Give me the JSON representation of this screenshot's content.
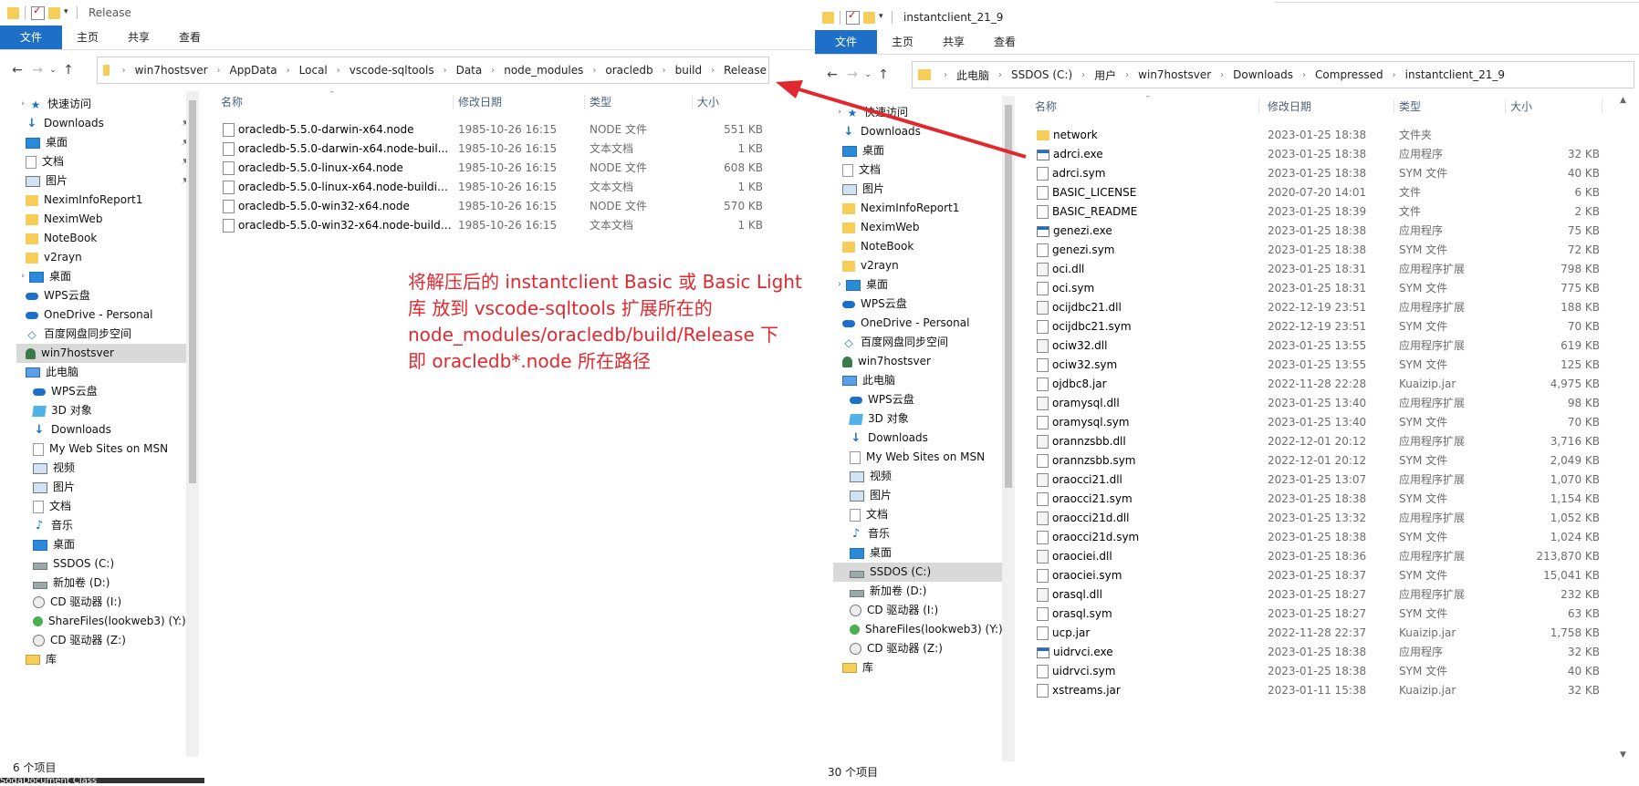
{
  "left": {
    "title": "Release",
    "ribbon_tabs": [
      "文件",
      "主页",
      "共享",
      "查看"
    ],
    "breadcrumb": [
      "win7hostsver",
      "AppData",
      "Local",
      "vscode-sqltools",
      "Data",
      "node_modules",
      "oracledb",
      "build",
      "Release"
    ],
    "nav": [
      {
        "label": "快速访问",
        "icon": "star-icon",
        "level": 0
      },
      {
        "label": "Downloads",
        "icon": "download-icon",
        "level": 1,
        "pinned": true
      },
      {
        "label": "桌面",
        "icon": "desktop-icon",
        "level": 1,
        "pinned": true
      },
      {
        "label": "文档",
        "icon": "document-icon",
        "level": 1,
        "pinned": true
      },
      {
        "label": "图片",
        "icon": "picture-icon",
        "level": 1,
        "pinned": true
      },
      {
        "label": "NeximInfoReport1",
        "icon": "folder-icon",
        "level": 1
      },
      {
        "label": "NeximWeb",
        "icon": "folder-icon",
        "level": 1
      },
      {
        "label": "NoteBook",
        "icon": "folder-icon",
        "level": 1
      },
      {
        "label": "v2rayn",
        "icon": "folder-icon",
        "level": 1
      },
      {
        "label": "桌面",
        "icon": "desktop-icon",
        "level": 0
      },
      {
        "label": "WPS云盘",
        "icon": "cloud-icon",
        "level": 1
      },
      {
        "label": "OneDrive - Personal",
        "icon": "cloud-icon",
        "level": 1
      },
      {
        "label": "百度网盘同步空间",
        "icon": "baidu-icon",
        "level": 1
      },
      {
        "label": "win7hostsver",
        "icon": "user-icon",
        "level": 1,
        "selected": true
      },
      {
        "label": "此电脑",
        "icon": "computer-icon",
        "level": 1
      },
      {
        "label": "WPS云盘",
        "icon": "cloud-icon",
        "level": 2
      },
      {
        "label": "3D 对象",
        "icon": "cube-icon",
        "level": 2
      },
      {
        "label": "Downloads",
        "icon": "download-icon",
        "level": 2
      },
      {
        "label": "My Web Sites on MSN",
        "icon": "document-icon",
        "level": 2
      },
      {
        "label": "视频",
        "icon": "video-icon",
        "level": 2
      },
      {
        "label": "图片",
        "icon": "picture-icon",
        "level": 2
      },
      {
        "label": "文档",
        "icon": "document-icon",
        "level": 2
      },
      {
        "label": "音乐",
        "icon": "music-icon",
        "level": 2
      },
      {
        "label": "桌面",
        "icon": "desktop-icon",
        "level": 2
      },
      {
        "label": "SSDOS (C:)",
        "icon": "drive-icon",
        "level": 2
      },
      {
        "label": "新加卷 (D:)",
        "icon": "drive-icon",
        "level": 2
      },
      {
        "label": "CD 驱动器 (I:)",
        "icon": "cd-icon",
        "level": 2
      },
      {
        "label": "ShareFiles(lookweb3) (Y:)",
        "icon": "network-drive-icon",
        "level": 2
      },
      {
        "label": "CD 驱动器 (Z:)",
        "icon": "cd-icon",
        "level": 2
      },
      {
        "label": "库",
        "icon": "library-icon",
        "level": 1
      }
    ],
    "columns": [
      "名称",
      "修改日期",
      "类型",
      "大小"
    ],
    "files": [
      {
        "name": "oracledb-5.5.0-darwin-x64.node",
        "date": "1985-10-26 16:15",
        "type": "NODE 文件",
        "size": "551 KB"
      },
      {
        "name": "oracledb-5.5.0-darwin-x64.node-buil...",
        "date": "1985-10-26 16:15",
        "type": "文本文档",
        "size": "1 KB"
      },
      {
        "name": "oracledb-5.5.0-linux-x64.node",
        "date": "1985-10-26 16:15",
        "type": "NODE 文件",
        "size": "608 KB"
      },
      {
        "name": "oracledb-5.5.0-linux-x64.node-buildin...",
        "date": "1985-10-26 16:15",
        "type": "文本文档",
        "size": "1 KB"
      },
      {
        "name": "oracledb-5.5.0-win32-x64.node",
        "date": "1985-10-26 16:15",
        "type": "NODE 文件",
        "size": "570 KB"
      },
      {
        "name": "oracledb-5.5.0-win32-x64.node-buildi...",
        "date": "1985-10-26 16:15",
        "type": "文本文档",
        "size": "1 KB"
      }
    ],
    "status": "6 个项目",
    "bottom_text": "SodaDocument Class"
  },
  "annotation": [
    "将解压后的 instantclient Basic 或 Basic Light",
    "库 放到 vscode-sqltools 扩展所在的",
    "node_modules/oracledb/build/Release 下",
    "即 oracledb*.node 所在路径"
  ],
  "annotation_color": "#e0282e",
  "right": {
    "title": "instantclient_21_9",
    "ribbon_tabs": [
      "文件",
      "主页",
      "共享",
      "查看"
    ],
    "breadcrumb": [
      "此电脑",
      "SSDOS (C:)",
      "用户",
      "win7hostsver",
      "Downloads",
      "Compressed",
      "instantclient_21_9"
    ],
    "nav": [
      {
        "label": "快速访问",
        "icon": "star-icon",
        "level": 0
      },
      {
        "label": "Downloads",
        "icon": "download-icon",
        "level": 1,
        "pinned": true
      },
      {
        "label": "桌面",
        "icon": "desktop-icon",
        "level": 1,
        "pinned": true
      },
      {
        "label": "文档",
        "icon": "document-icon",
        "level": 1,
        "pinned": true
      },
      {
        "label": "图片",
        "icon": "picture-icon",
        "level": 1,
        "pinned": true
      },
      {
        "label": "NeximInfoReport1",
        "icon": "folder-icon",
        "level": 1
      },
      {
        "label": "NeximWeb",
        "icon": "folder-icon",
        "level": 1
      },
      {
        "label": "NoteBook",
        "icon": "folder-icon",
        "level": 1
      },
      {
        "label": "v2rayn",
        "icon": "folder-icon",
        "level": 1
      },
      {
        "label": "桌面",
        "icon": "desktop-icon",
        "level": 0
      },
      {
        "label": "WPS云盘",
        "icon": "cloud-icon",
        "level": 1
      },
      {
        "label": "OneDrive - Personal",
        "icon": "cloud-icon",
        "level": 1
      },
      {
        "label": "百度网盘同步空间",
        "icon": "baidu-icon",
        "level": 1
      },
      {
        "label": "win7hostsver",
        "icon": "user-icon",
        "level": 1
      },
      {
        "label": "此电脑",
        "icon": "computer-icon",
        "level": 1
      },
      {
        "label": "WPS云盘",
        "icon": "cloud-icon",
        "level": 2
      },
      {
        "label": "3D 对象",
        "icon": "cube-icon",
        "level": 2
      },
      {
        "label": "Downloads",
        "icon": "download-icon",
        "level": 2
      },
      {
        "label": "My Web Sites on MSN",
        "icon": "document-icon",
        "level": 2
      },
      {
        "label": "视频",
        "icon": "video-icon",
        "level": 2
      },
      {
        "label": "图片",
        "icon": "picture-icon",
        "level": 2
      },
      {
        "label": "文档",
        "icon": "document-icon",
        "level": 2
      },
      {
        "label": "音乐",
        "icon": "music-icon",
        "level": 2
      },
      {
        "label": "桌面",
        "icon": "desktop-icon",
        "level": 2
      },
      {
        "label": "SSDOS (C:)",
        "icon": "drive-icon",
        "level": 2,
        "selected": true
      },
      {
        "label": "新加卷 (D:)",
        "icon": "drive-icon",
        "level": 2
      },
      {
        "label": "CD 驱动器 (I:)",
        "icon": "cd-icon",
        "level": 2
      },
      {
        "label": "ShareFiles(lookweb3) (Y:)",
        "icon": "network-drive-icon",
        "level": 2
      },
      {
        "label": "CD 驱动器 (Z:)",
        "icon": "cd-icon",
        "level": 2
      },
      {
        "label": "库",
        "icon": "library-icon",
        "level": 1
      }
    ],
    "columns": [
      "名称",
      "修改日期",
      "类型",
      "大小"
    ],
    "files": [
      {
        "name": "network",
        "date": "2023-01-25 18:38",
        "type": "文件夹",
        "size": "",
        "icon": "folder"
      },
      {
        "name": "adrci.exe",
        "date": "2023-01-25 18:38",
        "type": "应用程序",
        "size": "32 KB",
        "icon": "exe"
      },
      {
        "name": "adrci.sym",
        "date": "2023-01-25 18:38",
        "type": "SYM 文件",
        "size": "40 KB",
        "icon": "file"
      },
      {
        "name": "BASIC_LICENSE",
        "date": "2020-07-20 14:01",
        "type": "文件",
        "size": "6 KB",
        "icon": "file"
      },
      {
        "name": "BASIC_README",
        "date": "2023-01-25 18:39",
        "type": "文件",
        "size": "2 KB",
        "icon": "file"
      },
      {
        "name": "genezi.exe",
        "date": "2023-01-25 18:38",
        "type": "应用程序",
        "size": "75 KB",
        "icon": "exe"
      },
      {
        "name": "genezi.sym",
        "date": "2023-01-25 18:38",
        "type": "SYM 文件",
        "size": "72 KB",
        "icon": "file"
      },
      {
        "name": "oci.dll",
        "date": "2023-01-25 18:31",
        "type": "应用程序扩展",
        "size": "798 KB",
        "icon": "dll"
      },
      {
        "name": "oci.sym",
        "date": "2023-01-25 18:31",
        "type": "SYM 文件",
        "size": "775 KB",
        "icon": "file"
      },
      {
        "name": "ocijdbc21.dll",
        "date": "2022-12-19 23:51",
        "type": "应用程序扩展",
        "size": "188 KB",
        "icon": "dll"
      },
      {
        "name": "ocijdbc21.sym",
        "date": "2022-12-19 23:51",
        "type": "SYM 文件",
        "size": "70 KB",
        "icon": "file"
      },
      {
        "name": "ociw32.dll",
        "date": "2023-01-25 13:55",
        "type": "应用程序扩展",
        "size": "619 KB",
        "icon": "dll"
      },
      {
        "name": "ociw32.sym",
        "date": "2023-01-25 13:55",
        "type": "SYM 文件",
        "size": "125 KB",
        "icon": "file"
      },
      {
        "name": "ojdbc8.jar",
        "date": "2022-11-28 22:28",
        "type": "Kuaizip.jar",
        "size": "4,975 KB",
        "icon": "file"
      },
      {
        "name": "oramysql.dll",
        "date": "2023-01-25 13:40",
        "type": "应用程序扩展",
        "size": "98 KB",
        "icon": "dll"
      },
      {
        "name": "oramysql.sym",
        "date": "2023-01-25 13:40",
        "type": "SYM 文件",
        "size": "70 KB",
        "icon": "file"
      },
      {
        "name": "orannzsbb.dll",
        "date": "2022-12-01 20:12",
        "type": "应用程序扩展",
        "size": "3,716 KB",
        "icon": "dll"
      },
      {
        "name": "orannzsbb.sym",
        "date": "2022-12-01 20:12",
        "type": "SYM 文件",
        "size": "2,049 KB",
        "icon": "file"
      },
      {
        "name": "oraocci21.dll",
        "date": "2023-01-25 13:07",
        "type": "应用程序扩展",
        "size": "1,070 KB",
        "icon": "dll"
      },
      {
        "name": "oraocci21.sym",
        "date": "2023-01-25 18:38",
        "type": "SYM 文件",
        "size": "1,154 KB",
        "icon": "file"
      },
      {
        "name": "oraocci21d.dll",
        "date": "2023-01-25 13:32",
        "type": "应用程序扩展",
        "size": "1,052 KB",
        "icon": "dll"
      },
      {
        "name": "oraocci21d.sym",
        "date": "2023-01-25 18:38",
        "type": "SYM 文件",
        "size": "1,024 KB",
        "icon": "file"
      },
      {
        "name": "oraociei.dll",
        "date": "2023-01-25 18:36",
        "type": "应用程序扩展",
        "size": "213,870 KB",
        "icon": "dll"
      },
      {
        "name": "oraociei.sym",
        "date": "2023-01-25 18:37",
        "type": "SYM 文件",
        "size": "15,041 KB",
        "icon": "file"
      },
      {
        "name": "orasql.dll",
        "date": "2023-01-25 18:27",
        "type": "应用程序扩展",
        "size": "232 KB",
        "icon": "dll"
      },
      {
        "name": "orasql.sym",
        "date": "2023-01-25 18:27",
        "type": "SYM 文件",
        "size": "63 KB",
        "icon": "file"
      },
      {
        "name": "ucp.jar",
        "date": "2022-11-28 22:37",
        "type": "Kuaizip.jar",
        "size": "1,758 KB",
        "icon": "file"
      },
      {
        "name": "uidrvci.exe",
        "date": "2023-01-25 18:38",
        "type": "应用程序",
        "size": "32 KB",
        "icon": "exe"
      },
      {
        "name": "uidrvci.sym",
        "date": "2023-01-25 18:38",
        "type": "SYM 文件",
        "size": "40 KB",
        "icon": "file"
      },
      {
        "name": "xstreams.jar",
        "date": "2023-01-11 15:38",
        "type": "Kuaizip.jar",
        "size": "32 KB",
        "icon": "file"
      }
    ],
    "status": "30 个项目"
  },
  "colors": {
    "accent": "#1e6fc8",
    "annotation": "#e0282e",
    "folder": "#f6cd59"
  }
}
